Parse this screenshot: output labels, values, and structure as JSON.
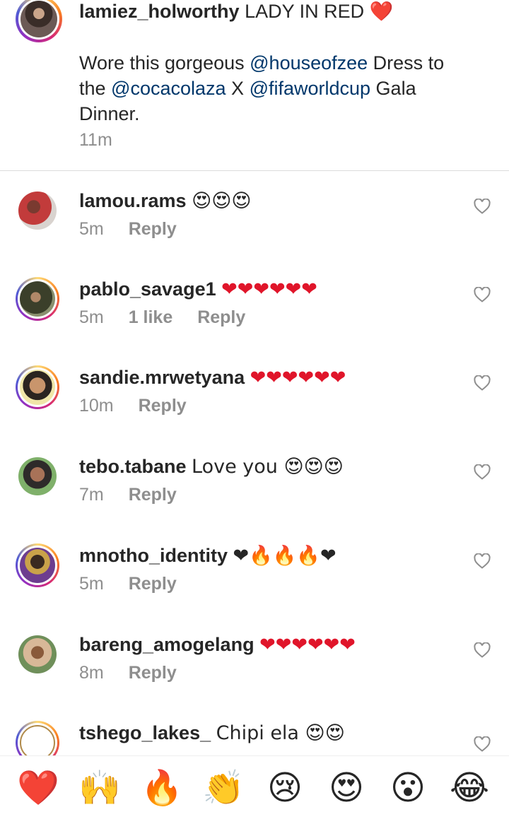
{
  "caption": {
    "username": "lamiez_holworthy",
    "title_text": "LADY IN RED",
    "title_emoji": "❤️",
    "body_1": "Wore this gorgeous ",
    "mention_1": "@houseofzee",
    "body_2": " Dress to the ",
    "mention_2": "@cocacolaza",
    "body_3": " X ",
    "mention_3": "@fifaworldcup",
    "body_4": " Gala Dinner.",
    "time": "11m"
  },
  "comments": [
    {
      "username": "lamou.rams",
      "text": "😍😍😍",
      "time": "5m",
      "likes": "",
      "reply": "Reply"
    },
    {
      "username": "pablo_savage1",
      "text": "❤❤❤❤❤❤",
      "time": "5m",
      "likes": "1 like",
      "reply": "Reply"
    },
    {
      "username": "sandie.mrwetyana",
      "text": "❤❤❤❤❤❤",
      "time": "10m",
      "likes": "",
      "reply": "Reply"
    },
    {
      "username": "tebo.tabane",
      "text": "Love you 😍😍😍",
      "time": "7m",
      "likes": "",
      "reply": "Reply"
    },
    {
      "username": "mnotho_identity",
      "text": "❤🔥🔥🔥❤",
      "time": "5m",
      "likes": "",
      "reply": "Reply"
    },
    {
      "username": "bareng_amogelang",
      "text": "❤❤❤❤❤❤",
      "time": "8m",
      "likes": "",
      "reply": "Reply"
    },
    {
      "username": "tshego_lakes_",
      "text": "Chipi ela 😍😍",
      "time": "",
      "likes": "",
      "reply": ""
    }
  ],
  "emoji_bar": [
    "❤️",
    "🙌",
    "🔥",
    "👏",
    "😢",
    "😍",
    "😮",
    "😂"
  ],
  "colors": {
    "text": "#262626",
    "secondary": "#8e8e8e",
    "mention": "#00376b",
    "divider": "#dbdbdb"
  }
}
